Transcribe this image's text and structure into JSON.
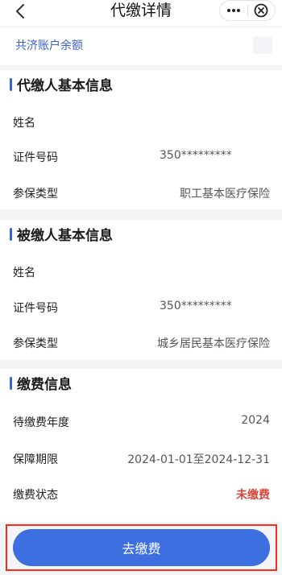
{
  "nav": {
    "title": "代缴详情"
  },
  "balance": {
    "label": "共济账户余额"
  },
  "payer": {
    "title": "代缴人基本信息",
    "rows": [
      {
        "key": "姓名",
        "value": ""
      },
      {
        "key": "证件号码",
        "value": "350*********"
      },
      {
        "key": "参保类型",
        "value": "职工基本医疗保险"
      }
    ]
  },
  "payee": {
    "title": "被缴人基本信息",
    "rows": [
      {
        "key": "姓名",
        "value": ""
      },
      {
        "key": "证件号码",
        "value": "350*********"
      },
      {
        "key": "参保类型",
        "value": "城乡居民基本医疗保险"
      }
    ]
  },
  "payment": {
    "title": "缴费信息",
    "rows": [
      {
        "key": "待缴费年度",
        "value": "2024"
      },
      {
        "key": "保障期限",
        "value": "2024-01-01至2024-12-31"
      },
      {
        "key": "缴费状态",
        "value": "未缴费"
      }
    ]
  },
  "action": {
    "pay_label": "去缴费"
  },
  "colors": {
    "accent": "#3e6fe0",
    "section_bar": "#3a63c8",
    "link": "#3b62c9",
    "status_unpaid": "#d9453b",
    "highlight_border": "#ff2a1a"
  }
}
